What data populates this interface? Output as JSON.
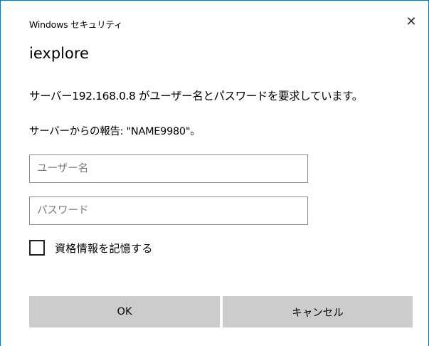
{
  "window": {
    "title": "Windows セキュリティ",
    "close_icon": "close-icon",
    "close_glyph": "✕"
  },
  "app_name": "iexplore",
  "message": "サーバー192.168.0.8 がユーザー名とパスワードを要求しています。",
  "server_report": "サーバーからの報告: \"NAME9980\"。",
  "username_field": {
    "value": "",
    "placeholder": "ユーザー名"
  },
  "password_field": {
    "value": "",
    "placeholder": "パスワード"
  },
  "remember": {
    "label": "資格情報を記憶する",
    "checked": false
  },
  "buttons": {
    "ok": "OK",
    "cancel": "キャンセル"
  },
  "colors": {
    "window_border": "#1f6fb5",
    "button_bg": "#cccccc",
    "field_border": "#8a8a8a"
  }
}
